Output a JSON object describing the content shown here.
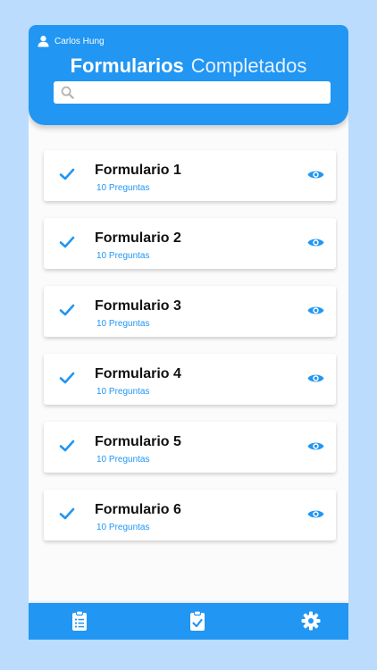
{
  "header": {
    "user_name": "Carlos Hung",
    "title_strong": "Formularios",
    "title_light": "Completados",
    "search_placeholder": ""
  },
  "forms": [
    {
      "name": "Formulario 1",
      "questions": "10 Preguntas"
    },
    {
      "name": "Formulario 2",
      "questions": "10 Preguntas"
    },
    {
      "name": "Formulario 3",
      "questions": "10 Preguntas"
    },
    {
      "name": "Formulario 4",
      "questions": "10 Preguntas"
    },
    {
      "name": "Formulario 5",
      "questions": "10 Preguntas"
    },
    {
      "name": "Formulario 6",
      "questions": "10 Preguntas"
    }
  ],
  "icons": {
    "user": "user-icon",
    "search": "search-icon",
    "check": "check-icon",
    "view": "eye-icon",
    "tab_forms": "clipboard-list-icon",
    "tab_completed": "clipboard-check-icon",
    "tab_settings": "gear-icon"
  },
  "colors": {
    "primary": "#2196f3",
    "background": "#bcdcfd",
    "surface": "#fbfbfb",
    "text": "#111111"
  }
}
